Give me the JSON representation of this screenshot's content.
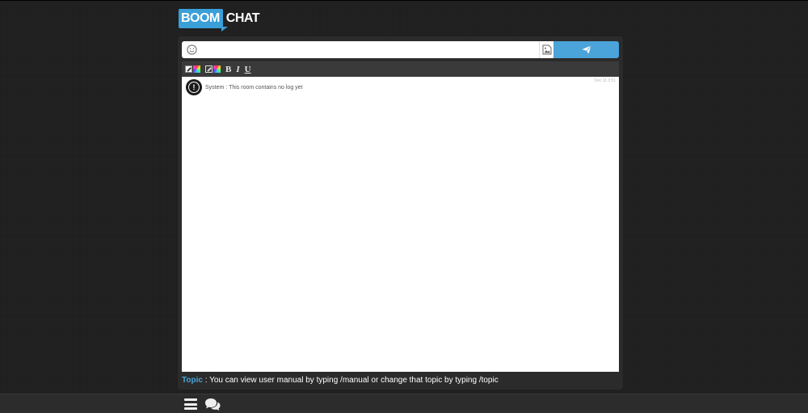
{
  "logo": {
    "part1": "BOOM",
    "part2": "CHAT"
  },
  "composer": {
    "message_value": "",
    "message_placeholder": "",
    "emoji_icon": "smiley-icon",
    "image_icon": "image-upload-icon",
    "send_icon": "paper-plane-icon"
  },
  "toolbar": {
    "bold_label": "B",
    "italic_label": "I",
    "underline_label": "U"
  },
  "log": {
    "messages": [
      {
        "sender": "System",
        "separator": " : ",
        "text": "This room contains no log yet",
        "time": "Dec 11 3:51"
      }
    ]
  },
  "topic": {
    "label": "Topic",
    "separator": " : ",
    "text": "You can view user manual by typing /manual or change that topic by typing /topic"
  },
  "bottom_bar": {
    "menu_icon": "hamburger-menu-icon",
    "chats_icon": "chat-bubbles-icon"
  },
  "colors": {
    "accent": "#4aa3d9",
    "background": "#1f1f1f",
    "panel": "#2b2b2b"
  }
}
